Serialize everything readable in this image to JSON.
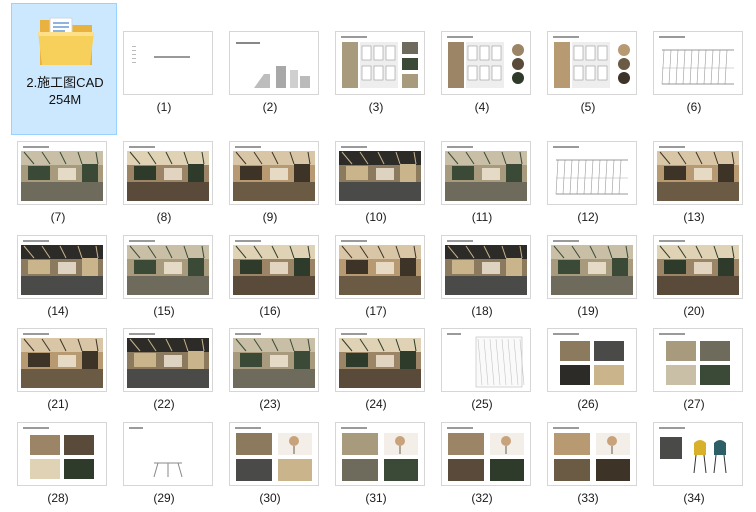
{
  "folder": {
    "name": "2.施工图CAD",
    "size": "254M"
  },
  "thumbs": [
    {
      "label": "(1)",
      "kind": "doc"
    },
    {
      "label": "(2)",
      "kind": "skyline"
    },
    {
      "label": "(3)",
      "kind": "plan"
    },
    {
      "label": "(4)",
      "kind": "plan2"
    },
    {
      "label": "(5)",
      "kind": "plan3"
    },
    {
      "label": "(6)",
      "kind": "sketch"
    },
    {
      "label": "(7)",
      "kind": "render"
    },
    {
      "label": "(8)",
      "kind": "render"
    },
    {
      "label": "(9)",
      "kind": "render"
    },
    {
      "label": "(10)",
      "kind": "render"
    },
    {
      "label": "(11)",
      "kind": "render"
    },
    {
      "label": "(12)",
      "kind": "sketch"
    },
    {
      "label": "(13)",
      "kind": "render"
    },
    {
      "label": "(14)",
      "kind": "render"
    },
    {
      "label": "(15)",
      "kind": "render"
    },
    {
      "label": "(16)",
      "kind": "render"
    },
    {
      "label": "(17)",
      "kind": "render"
    },
    {
      "label": "(18)",
      "kind": "render"
    },
    {
      "label": "(19)",
      "kind": "render"
    },
    {
      "label": "(20)",
      "kind": "render"
    },
    {
      "label": "(21)",
      "kind": "render"
    },
    {
      "label": "(22)",
      "kind": "render"
    },
    {
      "label": "(23)",
      "kind": "render"
    },
    {
      "label": "(24)",
      "kind": "render"
    },
    {
      "label": "(25)",
      "kind": "pattern"
    },
    {
      "label": "(26)",
      "kind": "materials"
    },
    {
      "label": "(27)",
      "kind": "materials"
    },
    {
      "label": "(28)",
      "kind": "materials2"
    },
    {
      "label": "(29)",
      "kind": "furniture"
    },
    {
      "label": "(30)",
      "kind": "furniture2"
    },
    {
      "label": "(31)",
      "kind": "furniture2"
    },
    {
      "label": "(32)",
      "kind": "furniture2"
    },
    {
      "label": "(33)",
      "kind": "furniture3"
    },
    {
      "label": "(34)",
      "kind": "chairs"
    }
  ],
  "colors": {
    "selection_bg": "#cce8ff",
    "selection_border": "#99d1ff",
    "folder": "#f7cf5b"
  }
}
